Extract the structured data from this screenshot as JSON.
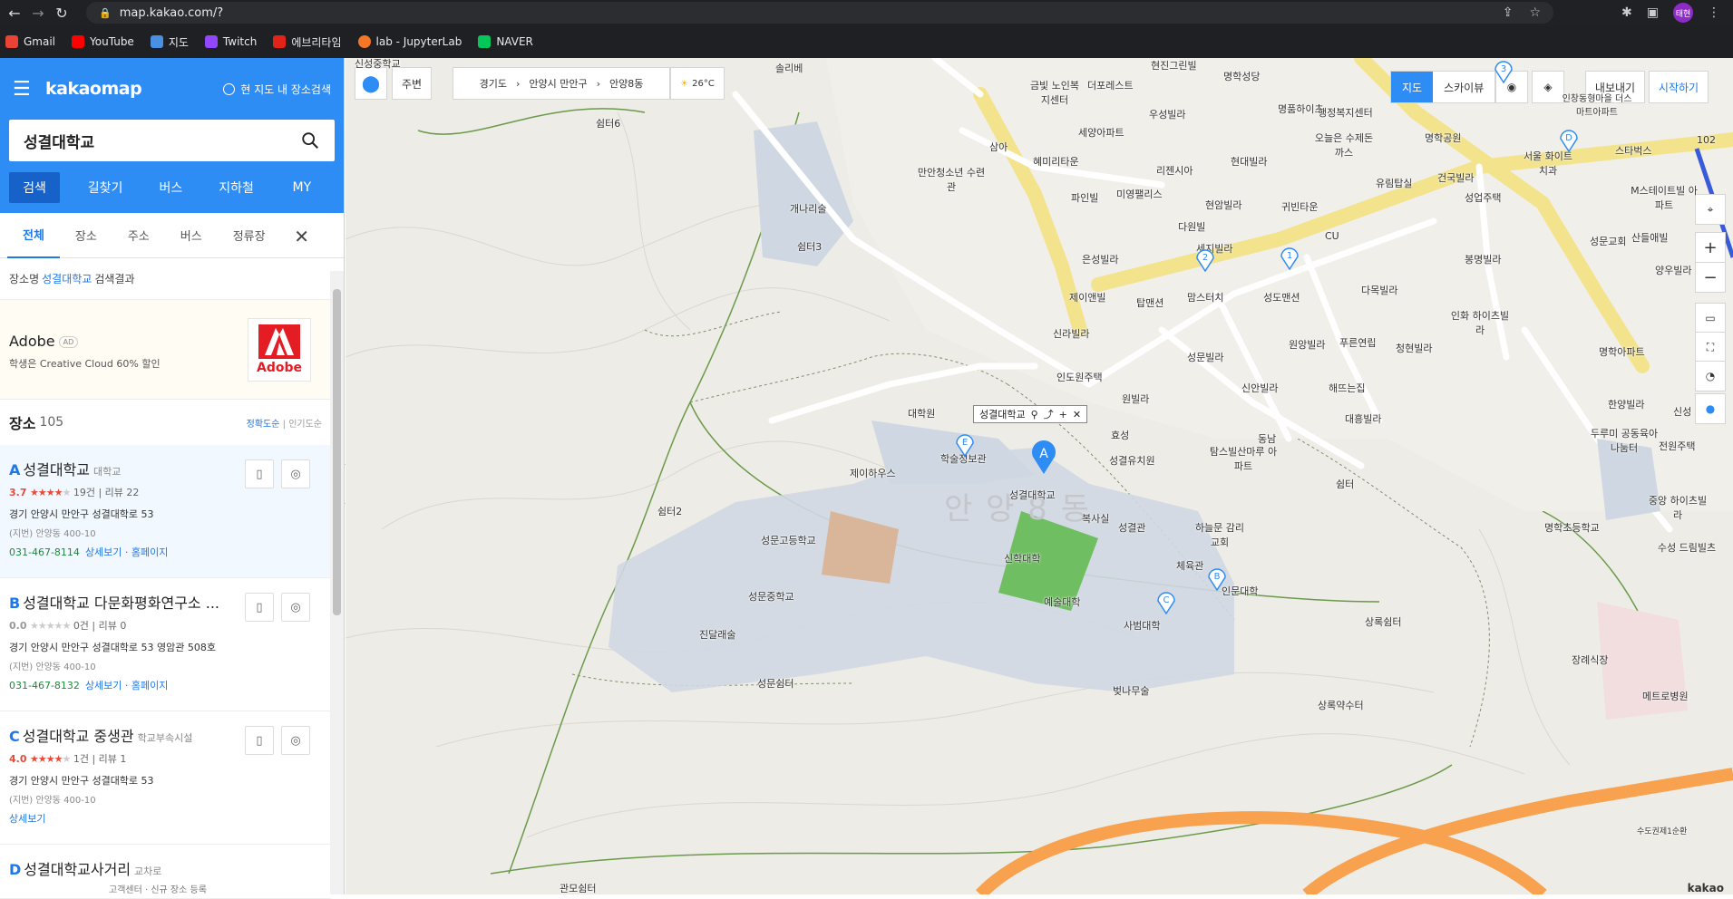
{
  "browser": {
    "url": "map.kakao.com/?",
    "profile": "태현",
    "bookmarks": [
      {
        "label": "Gmail",
        "color": "#ea4335"
      },
      {
        "label": "YouTube",
        "color": "#ff0000"
      },
      {
        "label": "지도",
        "color": "#4a90e2"
      },
      {
        "label": "Twitch",
        "color": "#9146ff"
      },
      {
        "label": "에브리타임",
        "color": "#e2231a"
      },
      {
        "label": "lab - JupyterLab",
        "color": "#f37726"
      },
      {
        "label": "NAVER",
        "color": "#03c75a"
      }
    ]
  },
  "sidebar": {
    "logo": "kakaomap",
    "current_search": "현 지도 내 장소검색",
    "search_value": "성결대학교",
    "tabs": [
      "검색",
      "길찾기",
      "버스",
      "지하철",
      "MY"
    ],
    "subtabs": [
      "전체",
      "장소",
      "주소",
      "버스",
      "정류장"
    ],
    "result_prefix": "장소명",
    "result_keyword": "성결대학교",
    "result_suffix": "검색결과",
    "ad": {
      "title": "Adobe",
      "badge": "AD",
      "desc": "학생은 Creative Cloud 60% 할인",
      "logo_word": "Adobe"
    },
    "places_label": "장소",
    "places_count": "105",
    "sort_accuracy": "정확도순",
    "sort_popular": "인기도순",
    "sort_sep": "|",
    "items": [
      {
        "letter": "A",
        "name": "성결대학교",
        "category": "대학교",
        "rating": "3.7",
        "stars_on": "★★★★",
        "stars_off": "★",
        "reviews": "19건",
        "review_count": "리뷰 22",
        "addr": "경기 안양시 만안구 성결대학로 53",
        "jibun": "(지번) 안양동 400-10",
        "tel": "031-467-8114",
        "link1": "상세보기",
        "link2": "홈페이지"
      },
      {
        "letter": "B",
        "name": "성결대학교 다문화평화연구소 ...",
        "category": "",
        "rating": "0.0",
        "stars_on": "",
        "stars_off": "★★★★★",
        "reviews": "0건",
        "review_count": "리뷰 0",
        "addr": "경기 안양시 만안구 성결대학로 53 영암관 508호",
        "jibun": "(지번) 안양동 400-10",
        "tel": "031-467-8132",
        "link1": "상세보기",
        "link2": "홈페이지"
      },
      {
        "letter": "C",
        "name": "성결대학교 중생관",
        "category": "학교부속시설",
        "rating": "4.0",
        "stars_on": "★★★★",
        "stars_off": "★",
        "reviews": "1건",
        "review_count": "리뷰 1",
        "addr": "경기 안양시 만안구 성결대학로 53",
        "jibun": "(지번) 안양동 400-10",
        "tel": "",
        "link1": "상세보기",
        "link2": ""
      },
      {
        "letter": "D",
        "name": "성결대학교사거리",
        "category": "교차로",
        "rating": "",
        "stars_on": "",
        "stars_off": "",
        "reviews": "",
        "review_count": "",
        "addr": "",
        "jibun": "",
        "tel": "",
        "link1": "",
        "link2": ""
      }
    ],
    "footer": "고객센터 · 신규 장소 등록"
  },
  "map": {
    "nearby": "주변",
    "breadcrumb": [
      "경기도",
      "안양시 만안구",
      "안양8동"
    ],
    "weather": "26°C",
    "layers": [
      "지도",
      "스카이뷰"
    ],
    "export": "내보내기",
    "start": "시작하기",
    "tooltip": "성결대학교",
    "district": "안 양 8 동",
    "watermark": "kakao",
    "labels": [
      {
        "t": "솔리베"
      },
      {
        "t": "금빛 노인복지센터"
      },
      {
        "t": "더포레스트"
      },
      {
        "t": "현진그린빌"
      },
      {
        "t": "명학성당"
      },
      {
        "t": "쉼터6"
      },
      {
        "t": "우성빌라"
      },
      {
        "t": "명품하이츠"
      },
      {
        "t": "세양아파트"
      },
      {
        "t": "삼아"
      },
      {
        "t": "혜미리타운"
      },
      {
        "t": "리젠시아"
      },
      {
        "t": "현대빌라"
      },
      {
        "t": "오늘은 수제돈까스"
      },
      {
        "t": "명학공원"
      },
      {
        "t": "만안청소년 수련관"
      },
      {
        "t": "파인빌"
      },
      {
        "t": "미영팰리스"
      },
      {
        "t": "현암빌라"
      },
      {
        "t": "귀빈타운"
      },
      {
        "t": "유림탑실"
      },
      {
        "t": "건국빌라"
      },
      {
        "t": "개나리술"
      },
      {
        "t": "쉼터3"
      },
      {
        "t": "다원빌"
      },
      {
        "t": "CU"
      },
      {
        "t": "성업주택"
      },
      {
        "t": "은성빌라"
      },
      {
        "t": "세지빌라"
      },
      {
        "t": "봉명빌라"
      },
      {
        "t": "제이앤빌"
      },
      {
        "t": "탑맨션"
      },
      {
        "t": "맘스터치"
      },
      {
        "t": "성도맨션"
      },
      {
        "t": "다목빌라"
      },
      {
        "t": "신라빌라"
      },
      {
        "t": "원앙빌라"
      },
      {
        "t": "푸른연립"
      },
      {
        "t": "청현빌라"
      },
      {
        "t": "인화 하이츠빌라"
      },
      {
        "t": "인도원주택"
      },
      {
        "t": "성문빌라"
      },
      {
        "t": "원빌라"
      },
      {
        "t": "신안빌라"
      },
      {
        "t": "해뜨는집"
      },
      {
        "t": "대흥빌라"
      },
      {
        "t": "대학원"
      },
      {
        "t": "효성"
      },
      {
        "t": "동남"
      },
      {
        "t": "성결유치원"
      },
      {
        "t": "탐스빌산마루 아파트"
      },
      {
        "t": "학술정보관"
      },
      {
        "t": "제이하우스"
      },
      {
        "t": "쉼터"
      },
      {
        "t": "쉼터2"
      },
      {
        "t": "성결대학교"
      },
      {
        "t": "복사실"
      },
      {
        "t": "성결관"
      },
      {
        "t": "하늘문 감리교회"
      },
      {
        "t": "성문고등학교"
      },
      {
        "t": "신학대학"
      },
      {
        "t": "체육관"
      },
      {
        "t": "인문대학"
      },
      {
        "t": "성문중학교"
      },
      {
        "t": "예술대학"
      },
      {
        "t": "사범대학"
      },
      {
        "t": "상록쉼터"
      },
      {
        "t": "진달래술"
      },
      {
        "t": "성문쉼터"
      },
      {
        "t": "벚나무술"
      },
      {
        "t": "상록약수터"
      },
      {
        "t": "관모쉼터"
      },
      {
        "t": "스타벅스"
      },
      {
        "t": "서울 화이트치과"
      },
      {
        "t": "성문교회"
      },
      {
        "t": "M스테이트빌 아파트"
      },
      {
        "t": "산들애빌"
      },
      {
        "t": "양우빌라"
      },
      {
        "t": "명학아파트"
      },
      {
        "t": "한양빌라"
      },
      {
        "t": "두루미 공동육아나눔터"
      },
      {
        "t": "전원주택"
      },
      {
        "t": "중앙 하이츠빌라"
      },
      {
        "t": "명학초등학교"
      },
      {
        "t": "수성 드림빌츠"
      },
      {
        "t": "장례식장"
      },
      {
        "t": "메트로병원"
      },
      {
        "t": "102"
      },
      {
        "t": "신성"
      },
      {
        "t": "신성중학교"
      },
      {
        "t": "수도권제1순환"
      },
      {
        "t": "인창동형마을 더스마트아파트"
      },
      {
        "t": "행정복지센터"
      }
    ],
    "markers": [
      "A",
      "B",
      "C",
      "E",
      "1",
      "2",
      "3",
      "D"
    ]
  }
}
